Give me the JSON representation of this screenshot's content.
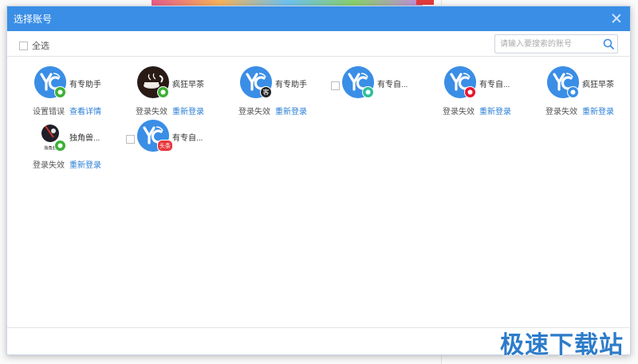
{
  "dialog": {
    "title": "选择账号",
    "select_all_label": "全选",
    "search_placeholder": "请输入要搜索的账号",
    "header_color": "#3a8ee6",
    "link_color": "#2b7fd6"
  },
  "accounts": [
    {
      "name": "有专助手",
      "status": "设置错误",
      "action": "查看详情",
      "platform": "wechat",
      "badge": "",
      "badge_color": "#3cb034",
      "avatar": "logo"
    },
    {
      "name": "疯狂早茶",
      "status": "登录失效",
      "action": "重新登录",
      "platform": "wechat",
      "badge": "",
      "badge_color": "#3cb034",
      "avatar": "coffee"
    },
    {
      "name": "有专助手",
      "status": "登录失效",
      "action": "重新登录",
      "platform": "toutiao-kr",
      "badge": "客",
      "badge_color": "#222222",
      "avatar": "logo"
    },
    {
      "name": "有专自...",
      "status": "",
      "action": "",
      "platform": "other",
      "badge": "",
      "badge_color": "#2bbf9d",
      "avatar": "logo"
    },
    {
      "name": "有专自...",
      "status": "登录失效",
      "action": "重新登录",
      "platform": "weibo",
      "badge": "",
      "badge_color": "#e6162d",
      "avatar": "logo"
    },
    {
      "name": "疯狂早茶",
      "status": "登录失效",
      "action": "重新登录",
      "platform": "baijia",
      "badge": "",
      "badge_color": "#3a8ee6",
      "avatar": "logo"
    },
    {
      "name": "独角兽...",
      "status": "登录失效",
      "action": "重新登录",
      "platform": "wechat",
      "badge": "",
      "badge_color": "#3cb034",
      "avatar": "unicorn"
    },
    {
      "name": "有专自...",
      "status": "",
      "action": "",
      "platform": "toutiao",
      "badge": "头条",
      "badge_color": "#e8383d",
      "avatar": "logo"
    }
  ],
  "watermark": "极速下载站"
}
